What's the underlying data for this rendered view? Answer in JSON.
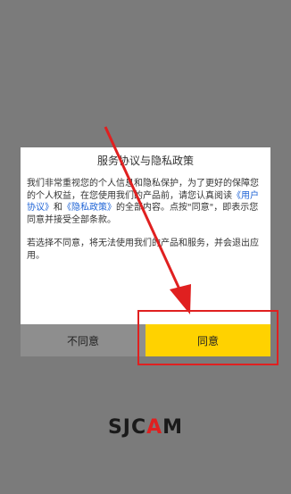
{
  "dialog": {
    "title": "服务协议与隐私政策",
    "para1_pre": "我们非常重视您的个人信息和隐私保护，为了更好的保障您的个人权益，在您使用我们的产品前，请您认真阅读",
    "link_user_agreement": "《用户协议》",
    "para1_and": "和",
    "link_privacy_policy": "《隐私政策》",
    "para1_post": "的全部内容。点按\"同意\"，即表示您同意并接受全部条款。",
    "para2": "若选择不同意，将无法使用我们的产品和服务，并会退出应用。",
    "disagree_label": "不同意",
    "agree_label": "同意"
  },
  "logo": {
    "part1": "SJC",
    "part2": "A",
    "part3": "M"
  },
  "colors": {
    "background": "#7b7b7b",
    "agree_button": "#ffd200",
    "disagree_button": "#8e8e8e",
    "annotation": "#e02020",
    "link": "#1f64d6"
  }
}
